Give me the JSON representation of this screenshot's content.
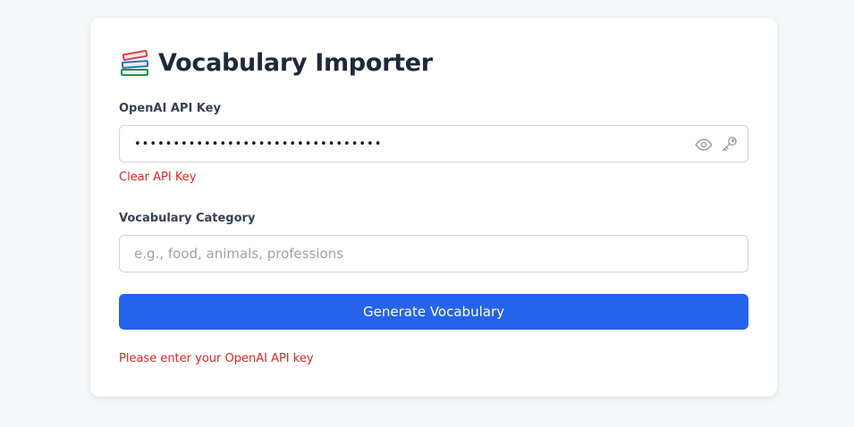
{
  "header": {
    "icon": "books-icon",
    "title": "Vocabulary Importer"
  },
  "api_key": {
    "label": "OpenAI API Key",
    "value": "••••••••••••••••••••••••••••••••",
    "icons": [
      "eye-icon",
      "key-icon"
    ],
    "clear_label": "Clear API Key"
  },
  "category": {
    "label": "Vocabulary Category",
    "placeholder": "e.g., food, animals, professions",
    "value": ""
  },
  "actions": {
    "generate_label": "Generate Vocabulary"
  },
  "status": {
    "error": "Please enter your OpenAI API key"
  },
  "colors": {
    "accent": "#2563eb",
    "error": "#dc2626",
    "background": "#f6f7f9",
    "card": "#ffffff",
    "title": "#1f2937"
  }
}
